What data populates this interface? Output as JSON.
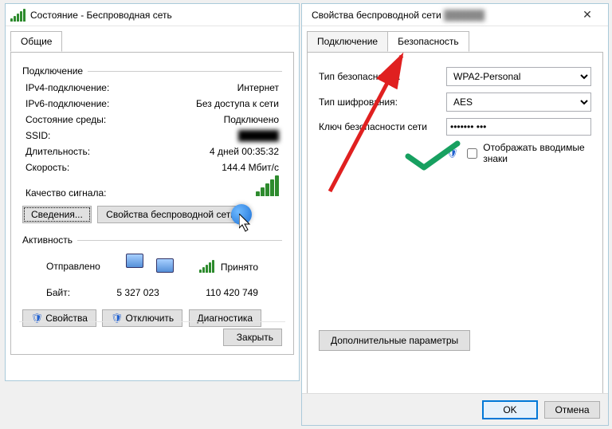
{
  "status_window": {
    "title": "Состояние - Беспроводная сеть",
    "tab_general": "Общие",
    "group_connection": "Подключение",
    "ipv4_label": "IPv4-подключение:",
    "ipv4_value": "Интернет",
    "ipv6_label": "IPv6-подключение:",
    "ipv6_value": "Без доступа к сети",
    "media_state_label": "Состояние среды:",
    "media_state_value": "Подключено",
    "ssid_label": "SSID:",
    "ssid_value": "██████",
    "duration_label": "Длительность:",
    "duration_value": "4 дней 00:35:32",
    "speed_label": "Скорость:",
    "speed_value": "144.4 Мбит/с",
    "signal_label": "Качество сигнала:",
    "btn_details": "Сведения...",
    "btn_wprops": "Свойства беспроводной сети",
    "group_activity": "Активность",
    "sent_label": "Отправлено",
    "recv_label": "Принято",
    "bytes_label": "Байт:",
    "bytes_sent": "5 327 023",
    "bytes_recv": "110 420 749",
    "btn_props": "Свойства",
    "btn_disable": "Отключить",
    "btn_diag": "Диагностика",
    "btn_close": "Закрыть"
  },
  "props_window": {
    "title_prefix": "Свойства беспроводной сети",
    "title_ssid": "██████",
    "tab_connection": "Подключение",
    "tab_security": "Безопасность",
    "sec_type_label": "Тип безопасности:",
    "sec_type_value": "WPA2-Personal",
    "enc_type_label": "Тип шифрования:",
    "enc_type_value": "AES",
    "key_label": "Ключ безопасности сети",
    "key_value": "••••••• •••",
    "show_chars_label": "Отображать вводимые знаки",
    "btn_advanced": "Дополнительные параметры",
    "btn_ok": "OK",
    "btn_cancel": "Отмена"
  }
}
